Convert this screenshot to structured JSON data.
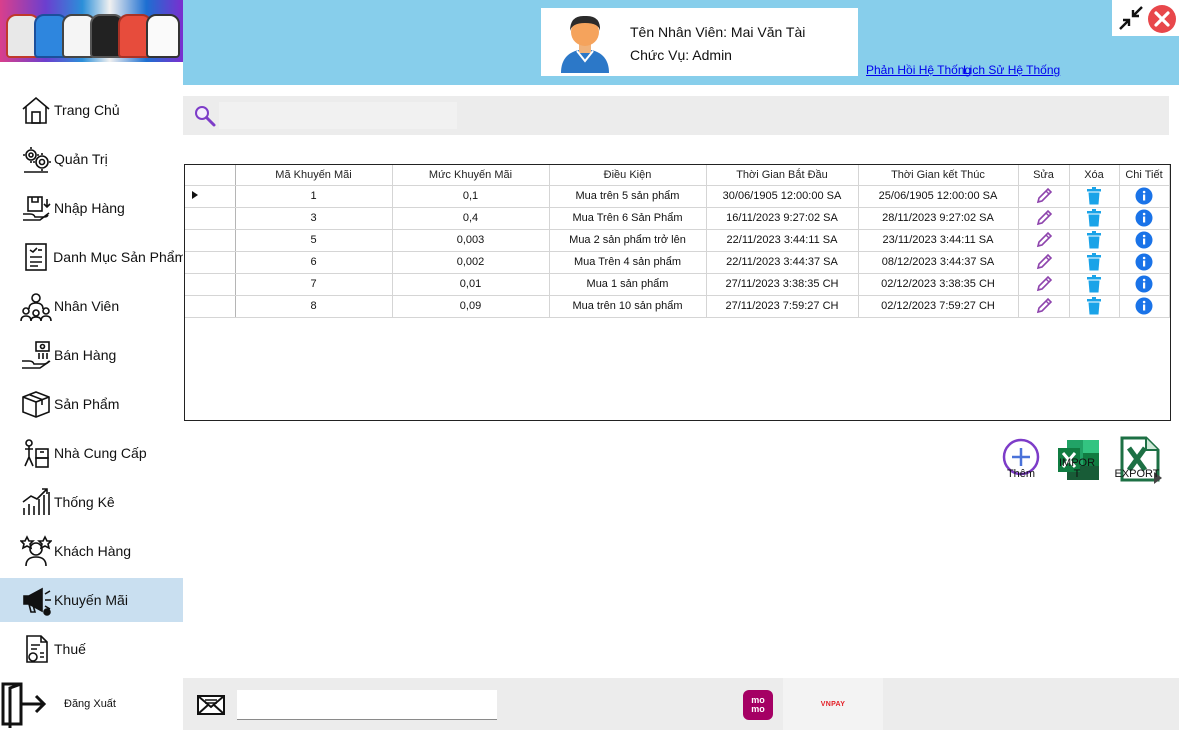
{
  "header": {
    "employee_name": "Tên Nhân Viên: Mai Văn Tài",
    "employee_role": "Chức Vụ: Admin",
    "links": [
      "Phản Hồi Hệ Thống",
      "Lịch Sử Hệ Thống"
    ]
  },
  "sidebar": {
    "items": [
      {
        "label": "Trang Chủ",
        "icon": "home-icon"
      },
      {
        "label": "Quản Trị",
        "icon": "admin-gears-icon"
      },
      {
        "label": "Nhập Hàng",
        "icon": "import-goods-icon"
      },
      {
        "label": "Danh Mục Sản Phẩm",
        "icon": "product-catalog-icon"
      },
      {
        "label": "Nhân Viên",
        "icon": "employees-icon"
      },
      {
        "label": "Bán Hàng",
        "icon": "sales-icon"
      },
      {
        "label": "Sản Phẩm",
        "icon": "product-box-icon"
      },
      {
        "label": "Nhà Cung Cấp",
        "icon": "supplier-icon"
      },
      {
        "label": "Thống Kê",
        "icon": "statistics-icon"
      },
      {
        "label": "Khách Hàng",
        "icon": "customers-icon"
      },
      {
        "label": "Khuyến Mãi",
        "icon": "promotion-megaphone-icon",
        "active": true
      },
      {
        "label": "Thuế",
        "icon": "tax-document-icon"
      }
    ],
    "logout_label": "Đăng Xuất"
  },
  "search": {
    "placeholder": ""
  },
  "table": {
    "columns": [
      "Mã Khuyến Mãi",
      "Mức Khuyến Mãi",
      "Điều Kiện",
      "Thời Gian Bắt Đầu",
      "Thời Gian kết Thúc",
      "Sửa",
      "Xóa",
      "Chi Tiết"
    ],
    "rows": [
      [
        "1",
        "0,1",
        "Mua trên 5 sản phẩm",
        "30/06/1905 12:00:00 SA",
        "25/06/1905 12:00:00 SA"
      ],
      [
        "3",
        "0,4",
        "Mua Trên 6 Sản Phẩm",
        "16/11/2023 9:27:02 SA",
        "28/11/2023 9:27:02 SA"
      ],
      [
        "5",
        "0,003",
        "Mua 2 sản phẩm trở lên",
        "22/11/2023 3:44:11 SA",
        "23/11/2023 3:44:11 SA"
      ],
      [
        "6",
        "0,002",
        "Mua Trên 4 sản phẩm",
        "22/11/2023 3:44:37 SA",
        "08/12/2023 3:44:37 SA"
      ],
      [
        "7",
        "0,01",
        "Mua 1 sản phẩm",
        "27/11/2023 3:38:35 CH",
        "02/12/2023 3:38:35 CH"
      ],
      [
        "8",
        "0,09",
        "Mua trên 10 sản phẩm",
        "27/11/2023 7:59:27 CH",
        "02/12/2023 7:59:27 CH"
      ]
    ],
    "selected_row": 0
  },
  "actions": {
    "add_label": "Thêm",
    "import_label": "IMPORT",
    "export_label": "EXPORT"
  },
  "bottom": {
    "message_placeholder": "",
    "momo_label": "mo mo",
    "vnpay_label": "VNPAY"
  },
  "colors": {
    "header_bg": "#87ceeb",
    "active_nav": "#c9dff0",
    "close_red": "#e8474b",
    "trash_blue": "#1aa3e8",
    "info_blue": "#1a73e8",
    "edit_purple": "#8e44ad",
    "excel_green": "#1d7044",
    "momo_pink": "#a50064"
  }
}
